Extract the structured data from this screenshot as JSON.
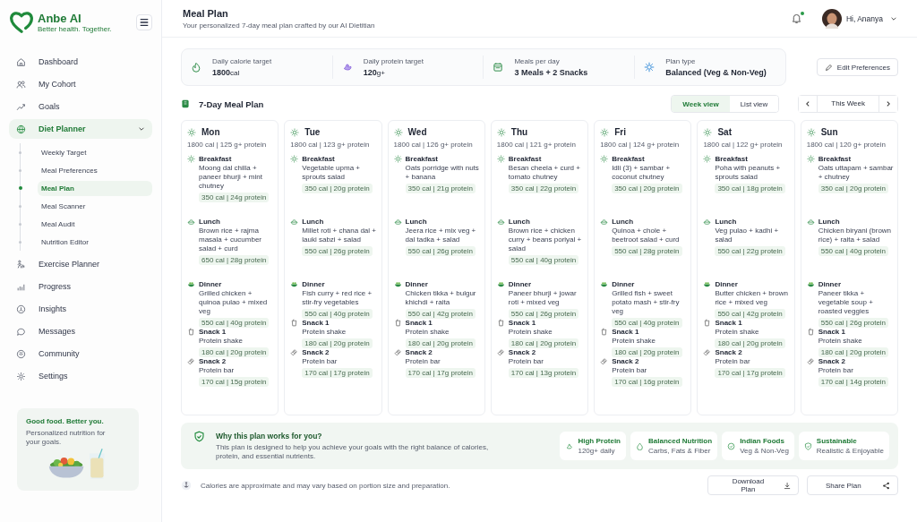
{
  "brand": {
    "name": "Anbe AI",
    "tagline": "Better health. Together."
  },
  "nav": [
    {
      "label": "Dashboard",
      "selected": false
    },
    {
      "label": "My Cohort",
      "selected": false
    },
    {
      "label": "Goals",
      "selected": false
    },
    {
      "label": "Diet Planner",
      "selected": true,
      "expanded": true,
      "children": [
        {
          "label": "Weekly Target",
          "selected": false
        },
        {
          "label": "Meal Preferences",
          "selected": false
        },
        {
          "label": "Meal Plan",
          "selected": true
        },
        {
          "label": "Meal Scanner",
          "selected": false
        },
        {
          "label": "Meal Audit",
          "selected": false
        },
        {
          "label": "Nutrition Editor",
          "selected": false
        }
      ]
    },
    {
      "label": "Exercise Planner",
      "selected": false
    },
    {
      "label": "Progress",
      "selected": false
    },
    {
      "label": "Insights",
      "selected": false
    },
    {
      "label": "Messages",
      "selected": false
    },
    {
      "label": "Community",
      "selected": false
    },
    {
      "label": "Settings",
      "selected": false
    }
  ],
  "promo": {
    "title": "Good food. Better you.",
    "text": "Personalized nutrition for your goals."
  },
  "header": {
    "title": "Meal Plan",
    "subtitle": "Your personalized 7-day meal plan crafted by our AI Dietitian",
    "unread_notifications": true,
    "greeting": "Hi, Ananya"
  },
  "summary": [
    {
      "kind": "calories",
      "label": "Daily calorie target",
      "value": "1800",
      "unit": "cal"
    },
    {
      "kind": "protein",
      "label": "Daily protein target",
      "value": "120",
      "unit": "g+"
    },
    {
      "kind": "meals",
      "label": "Meals per day",
      "value": "3 Meals + 2 Snacks"
    },
    {
      "kind": "plan",
      "label": "Plan type",
      "value": "Balanced (Veg & Non-Veg)"
    }
  ],
  "edit_button": "Edit Preferences",
  "plan": {
    "title": "7-Day Meal Plan",
    "views": [
      {
        "label": "Week view",
        "selected": true
      },
      {
        "label": "List view",
        "selected": false
      }
    ],
    "week": "This Week"
  },
  "days": [
    {
      "day": "Mon",
      "totals": "1800 cal | 125 g+ protein",
      "meals": [
        {
          "kind": "breakfast",
          "name": "Breakfast",
          "description": "Moong dal chilla + paneer bhurji + mint chutney",
          "nutrition": "350 cal | 24g protein"
        },
        {
          "kind": "lunch",
          "name": "Lunch",
          "description": "Brown rice + rajma masala + cucumber salad + curd",
          "nutrition": "650 cal | 28g protein"
        },
        {
          "kind": "dinner",
          "name": "Dinner",
          "description": "Grilled chicken + quinoa pulao + mixed veg",
          "nutrition": "550 cal | 40g protein"
        },
        {
          "kind": "shake",
          "name": "Snack 1",
          "description": "Protein shake",
          "nutrition": "180 cal | 20g protein"
        },
        {
          "kind": "bar",
          "name": "Snack 2",
          "description": "Protein bar",
          "nutrition": "170 cal | 15g protein"
        }
      ]
    },
    {
      "day": "Tue",
      "totals": "1800 cal | 123 g+ protein",
      "meals": [
        {
          "kind": "breakfast",
          "name": "Breakfast",
          "description": "Vegetable upma + sprouts salad",
          "nutrition": "350 cal | 20g protein"
        },
        {
          "kind": "lunch",
          "name": "Lunch",
          "description": "Millet roti + chana dal + lauki sabzi + salad",
          "nutrition": "550 cal | 26g protein"
        },
        {
          "kind": "dinner",
          "name": "Dinner",
          "description": "Fish curry + red rice + stir-fry vegetables",
          "nutrition": "550 cal | 40g protein"
        },
        {
          "kind": "shake",
          "name": "Snack 1",
          "description": "Protein shake",
          "nutrition": "180 cal | 20g protein"
        },
        {
          "kind": "bar",
          "name": "Snack 2",
          "description": "Protein bar",
          "nutrition": "170 cal | 17g protein"
        }
      ]
    },
    {
      "day": "Wed",
      "totals": "1800 cal | 126 g+ protein",
      "meals": [
        {
          "kind": "breakfast",
          "name": "Breakfast",
          "description": "Oats porridge with nuts + banana",
          "nutrition": "350 cal | 21g protein"
        },
        {
          "kind": "lunch",
          "name": "Lunch",
          "description": "Jeera rice + mix veg + dal tadka + salad",
          "nutrition": "550 cal | 26g protein"
        },
        {
          "kind": "dinner",
          "name": "Dinner",
          "description": "Chicken tikka + bulgur khichdi + raita",
          "nutrition": "550 cal | 42g protein"
        },
        {
          "kind": "shake",
          "name": "Snack 1",
          "description": "Protein shake",
          "nutrition": "180 cal | 20g protein"
        },
        {
          "kind": "bar",
          "name": "Snack 2",
          "description": "Protein bar",
          "nutrition": "170 cal | 17g protein"
        }
      ]
    },
    {
      "day": "Thu",
      "totals": "1800 cal | 121 g+ protein",
      "meals": [
        {
          "kind": "breakfast",
          "name": "Breakfast",
          "description": "Besan cheela + curd + tomato chutney",
          "nutrition": "350 cal | 22g protein"
        },
        {
          "kind": "lunch",
          "name": "Lunch",
          "description": "Brown rice + chicken curry + beans poriyal + salad",
          "nutrition": "550 cal | 40g protein"
        },
        {
          "kind": "dinner",
          "name": "Dinner",
          "description": "Paneer bhurji + jowar roti + mixed veg",
          "nutrition": "550 cal | 26g protein"
        },
        {
          "kind": "shake",
          "name": "Snack 1",
          "description": "Protein shake",
          "nutrition": "180 cal | 20g protein"
        },
        {
          "kind": "bar",
          "name": "Snack 2",
          "description": "Protein bar",
          "nutrition": "170 cal | 13g protein"
        }
      ]
    },
    {
      "day": "Fri",
      "totals": "1800 cal | 124 g+ protein",
      "meals": [
        {
          "kind": "breakfast",
          "name": "Breakfast",
          "description": "Idli (3) + sambar + coconut chutney",
          "nutrition": "350 cal | 20g protein"
        },
        {
          "kind": "lunch",
          "name": "Lunch",
          "description": "Quinoa + chole + beetroot salad + curd",
          "nutrition": "550 cal | 28g protein"
        },
        {
          "kind": "dinner",
          "name": "Dinner",
          "description": "Grilled fish + sweet potato mash + stir-fry veg",
          "nutrition": "550 cal | 40g protein"
        },
        {
          "kind": "shake",
          "name": "Snack 1",
          "description": "Protein shake",
          "nutrition": "180 cal | 20g protein"
        },
        {
          "kind": "bar",
          "name": "Snack 2",
          "description": "Protein bar",
          "nutrition": "170 cal | 16g protein"
        }
      ]
    },
    {
      "day": "Sat",
      "totals": "1800 cal | 122 g+ protein",
      "meals": [
        {
          "kind": "breakfast",
          "name": "Breakfast",
          "description": "Poha with peanuts + sprouts salad",
          "nutrition": "350 cal | 18g protein"
        },
        {
          "kind": "lunch",
          "name": "Lunch",
          "description": "Veg pulao + kadhi + salad",
          "nutrition": "550 cal | 22g protein"
        },
        {
          "kind": "dinner",
          "name": "Dinner",
          "description": "Butter chicken + brown rice + mixed veg",
          "nutrition": "550 cal | 42g protein"
        },
        {
          "kind": "shake",
          "name": "Snack 1",
          "description": "Protein shake",
          "nutrition": "180 cal | 20g protein"
        },
        {
          "kind": "bar",
          "name": "Snack 2",
          "description": "Protein bar",
          "nutrition": "170 cal | 17g protein"
        }
      ]
    },
    {
      "day": "Sun",
      "totals": "1800 cal | 120 g+ protein",
      "meals": [
        {
          "kind": "breakfast",
          "name": "Breakfast",
          "description": "Oats uttapam + sambar + chutney",
          "nutrition": "350 cal | 20g protein"
        },
        {
          "kind": "lunch",
          "name": "Lunch",
          "description": "Chicken biryani (brown rice) + raita + salad",
          "nutrition": "550 cal | 40g protein"
        },
        {
          "kind": "dinner",
          "name": "Dinner",
          "description": "Paneer tikka + vegetable soup + roasted veggies",
          "nutrition": "550 cal | 26g protein"
        },
        {
          "kind": "shake",
          "name": "Snack 1",
          "description": "Protein shake",
          "nutrition": "180 cal | 20g protein"
        },
        {
          "kind": "bar",
          "name": "Snack 2",
          "description": "Protein bar",
          "nutrition": "170 cal | 14g protein"
        }
      ]
    }
  ],
  "benefits": {
    "title": "Why this plan works for you?",
    "text": "This plan is designed to help you achieve your goals with the right balance of calories, protein, and essential nutrients.",
    "badges": [
      {
        "kind": "protein",
        "title": "High Protein",
        "subtitle": "120g+ daily"
      },
      {
        "kind": "balanced",
        "title": "Balanced Nutrition",
        "subtitle": "Carbs, Fats & Fiber"
      },
      {
        "kind": "indian",
        "title": "Indian Foods",
        "subtitle": "Veg & Non-Veg"
      },
      {
        "kind": "sustainable",
        "title": "Sustainable",
        "subtitle": "Realistic & Enjoyable"
      }
    ]
  },
  "footer": {
    "note": "Calories are approximate and may vary based on portion size and preparation.",
    "buttons": [
      {
        "kind": "download",
        "label": "Download Plan"
      },
      {
        "kind": "share",
        "label": "Share Plan"
      }
    ]
  }
}
